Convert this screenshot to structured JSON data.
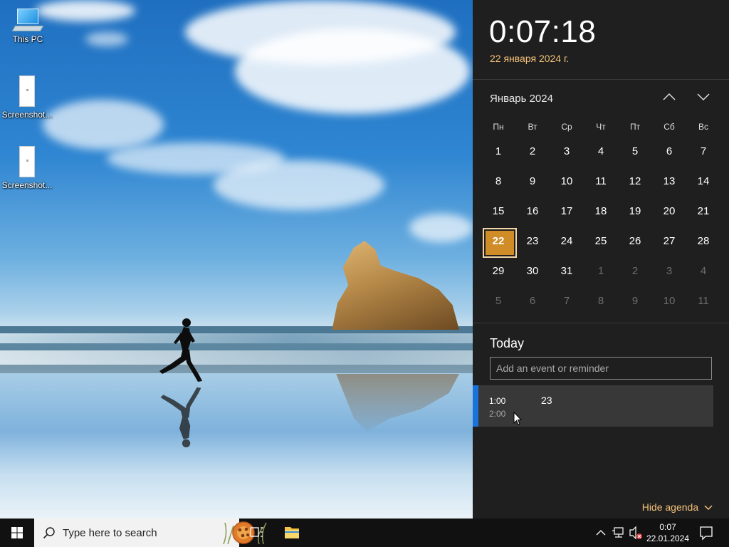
{
  "desktop": {
    "icons": [
      {
        "label": "This PC"
      },
      {
        "label": "Screenshot..."
      },
      {
        "label": "Screenshot..."
      }
    ]
  },
  "flyout": {
    "clock": "0:07:18",
    "date_full": "22 января 2024 г.",
    "month_title": "Январь 2024",
    "weekdays": [
      "Пн",
      "Вт",
      "Ср",
      "Чт",
      "Пт",
      "Сб",
      "Вс"
    ],
    "weeks": [
      [
        "1",
        "2",
        "3",
        "4",
        "5",
        "6",
        "7"
      ],
      [
        "8",
        "9",
        "10",
        "11",
        "12",
        "13",
        "14"
      ],
      [
        "15",
        "16",
        "17",
        "18",
        "19",
        "20",
        "21"
      ],
      [
        "22",
        "23",
        "24",
        "25",
        "26",
        "27",
        "28"
      ],
      [
        "29",
        "30",
        "31",
        "1",
        "2",
        "3",
        "4"
      ],
      [
        "5",
        "6",
        "7",
        "8",
        "9",
        "10",
        "11"
      ]
    ],
    "selected_day": "22",
    "today_title": "Today",
    "event_placeholder": "Add an event or reminder",
    "event": {
      "start": "1:00",
      "end": "2:00",
      "title": "23"
    },
    "hide_agenda": "Hide agenda",
    "accent_color": "#d08c26",
    "event_color": "#1a73d9"
  },
  "taskbar": {
    "search_placeholder": "Type here to search",
    "time": "0:07",
    "date": "22.01.2024"
  }
}
